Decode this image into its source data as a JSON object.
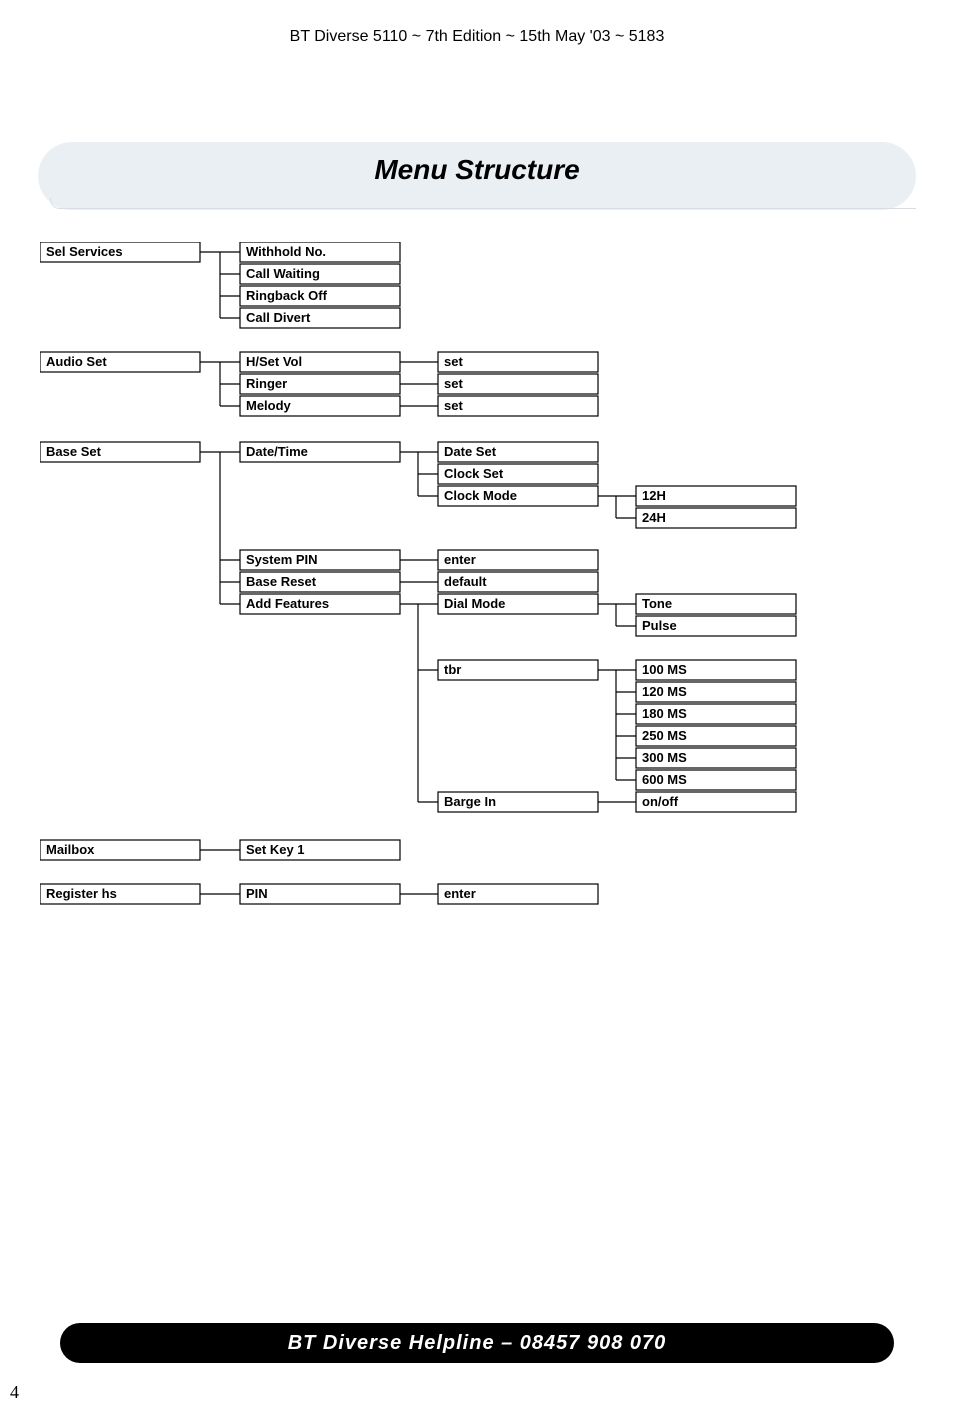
{
  "header": "BT Diverse 5110 ~ 7th Edition ~ 15th May '03 ~ 5183",
  "title": "Menu Structure",
  "footer": "BT Diverse Helpline – 08457 908 070",
  "page_number": "4",
  "menu": {
    "sel_services": {
      "label": "Sel Services",
      "children": {
        "withhold_no": "Withhold No.",
        "call_waiting": "Call Waiting",
        "ringback_off": "Ringback Off",
        "call_divert": "Call Divert"
      }
    },
    "audio_set": {
      "label": "Audio Set",
      "children": {
        "hset_vol": {
          "label": "H/Set Vol",
          "action": "set"
        },
        "ringer": {
          "label": "Ringer",
          "action": "set"
        },
        "melody": {
          "label": "Melody",
          "action": "set"
        }
      }
    },
    "base_set": {
      "label": "Base Set",
      "children": {
        "date_time": {
          "label": "Date/Time",
          "children": {
            "date_set": "Date Set",
            "clock_set": "Clock Set",
            "clock_mode": {
              "label": "Clock Mode",
              "options": {
                "h12": "12H",
                "h24": "24H"
              }
            }
          }
        },
        "system_pin": {
          "label": "System PIN",
          "action": "enter"
        },
        "base_reset": {
          "label": "Base Reset",
          "action": "default"
        },
        "add_features": {
          "label": "Add Features",
          "children": {
            "dial_mode": {
              "label": "Dial Mode",
              "options": {
                "tone": "Tone",
                "pulse": "Pulse"
              }
            },
            "tbr": {
              "label": "tbr",
              "options": {
                "ms100": "100 MS",
                "ms120": "120 MS",
                "ms180": "180 MS",
                "ms250": "250 MS",
                "ms300": "300 MS",
                "ms600": "600 MS"
              }
            },
            "barge_in": {
              "label": "Barge In",
              "option": "on/off"
            }
          }
        }
      }
    },
    "mailbox": {
      "label": "Mailbox",
      "children": {
        "set_key_1": "Set Key 1"
      }
    },
    "register_hs": {
      "label": "Register hs",
      "children": {
        "pin": {
          "label": "PIN",
          "action": "enter"
        }
      }
    }
  }
}
